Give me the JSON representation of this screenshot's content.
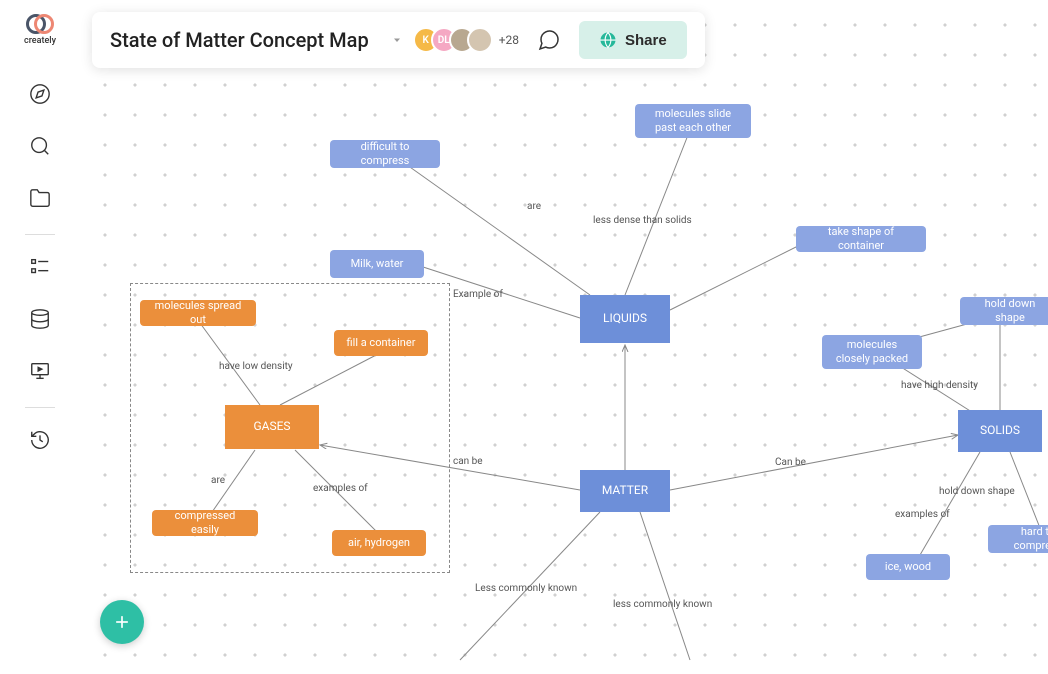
{
  "app": {
    "logo_text": "creately"
  },
  "topbar": {
    "title": "State of Matter Concept Map",
    "avatar_count": "+28",
    "share_label": "Share",
    "avatars": [
      {
        "label": "K",
        "bg": "#f5b947"
      },
      {
        "label": "DL",
        "bg": "#f5a8c3"
      },
      {
        "label": "",
        "bg": "#b8a890"
      },
      {
        "label": "",
        "bg": "#d4c5b0"
      }
    ]
  },
  "nodes": {
    "matter": "MATTER",
    "liquids": "LIQUIDS",
    "solids": "SOLIDS",
    "gases": "GASES",
    "difficult_compress": "difficult to compress",
    "molecules_slide": "molecules slide past each other",
    "take_shape": "take shape of container",
    "milk_water": "Milk, water",
    "hold_down_shape": "hold down shape",
    "molecules_closely": "molecules closely packed",
    "hard_compress": "hard to compress",
    "ice_wood": "ice, wood",
    "molecules_spread": "molecules spread out",
    "fill_container": "fill a container",
    "compressed_easily": "compressed easily",
    "air_hydrogen": "air, hydrogen"
  },
  "edges": {
    "are1": "are",
    "less_dense": "less dense than solids",
    "example_of1": "Example of",
    "can_be1": "can be",
    "can_be2": "Can be",
    "have_high_density": "have high density",
    "hold_down_shape_edge": "hold down shape",
    "examples_of1": "examples of",
    "have_low_density": "have low density",
    "are2": "are",
    "examples_of2": "examples of",
    "less_commonly1": "Less commonly known",
    "less_commonly2": "less commonly known"
  }
}
